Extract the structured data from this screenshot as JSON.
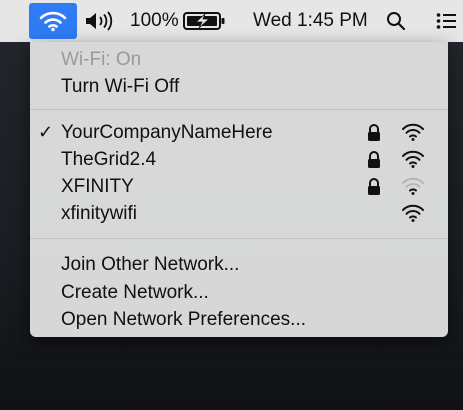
{
  "menubar": {
    "battery_percent": "100%",
    "clock": "Wed 1:45 PM"
  },
  "wifi_menu": {
    "status": "Wi-Fi: On",
    "toggle": "Turn Wi-Fi Off",
    "networks": [
      {
        "name": "YourCompanyNameHere",
        "connected": true,
        "secured": true,
        "signal_bars": 3
      },
      {
        "name": "TheGrid2.4",
        "connected": false,
        "secured": true,
        "signal_bars": 3
      },
      {
        "name": "XFINITY",
        "connected": false,
        "secured": true,
        "signal_bars": 1
      },
      {
        "name": "xfinitywifi",
        "connected": false,
        "secured": false,
        "signal_bars": 3
      }
    ],
    "connected_mark": "✓",
    "actions": {
      "join_other": "Join Other Network...",
      "create": "Create Network...",
      "preferences": "Open Network Preferences..."
    }
  },
  "colors": {
    "menubar_bg": "#e6e6e6",
    "active_highlight": "#2f7bf5",
    "menu_bg": "#dedede",
    "disabled_text": "#9a9a9a"
  }
}
